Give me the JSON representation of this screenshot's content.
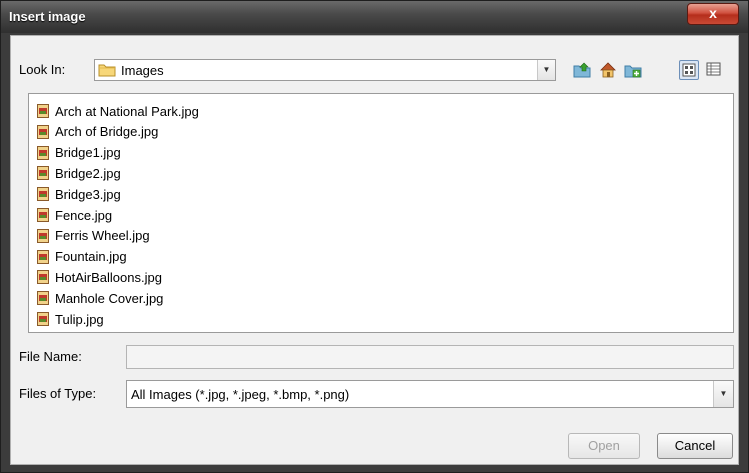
{
  "window": {
    "title": "Insert image",
    "close_label": "x"
  },
  "look_in": {
    "label": "Look In:",
    "value": "Images"
  },
  "toolbar": {
    "icons": [
      "up-folder-icon",
      "home-icon",
      "new-folder-icon",
      "list-view-icon",
      "details-view-icon"
    ]
  },
  "files": [
    "Arch at National Park.jpg",
    "Arch of Bridge.jpg",
    "Bridge1.jpg",
    "Bridge2.jpg",
    "Bridge3.jpg",
    "Fence.jpg",
    "Ferris Wheel.jpg",
    "Fountain.jpg",
    "HotAirBalloons.jpg",
    "Manhole Cover.jpg",
    "Tulip.jpg"
  ],
  "file_name": {
    "label": "File Name:",
    "value": ""
  },
  "file_type": {
    "label": "Files of Type:",
    "value": "All Images (*.jpg, *.jpeg, *.bmp, *.png)"
  },
  "buttons": {
    "open": "Open",
    "cancel": "Cancel"
  }
}
